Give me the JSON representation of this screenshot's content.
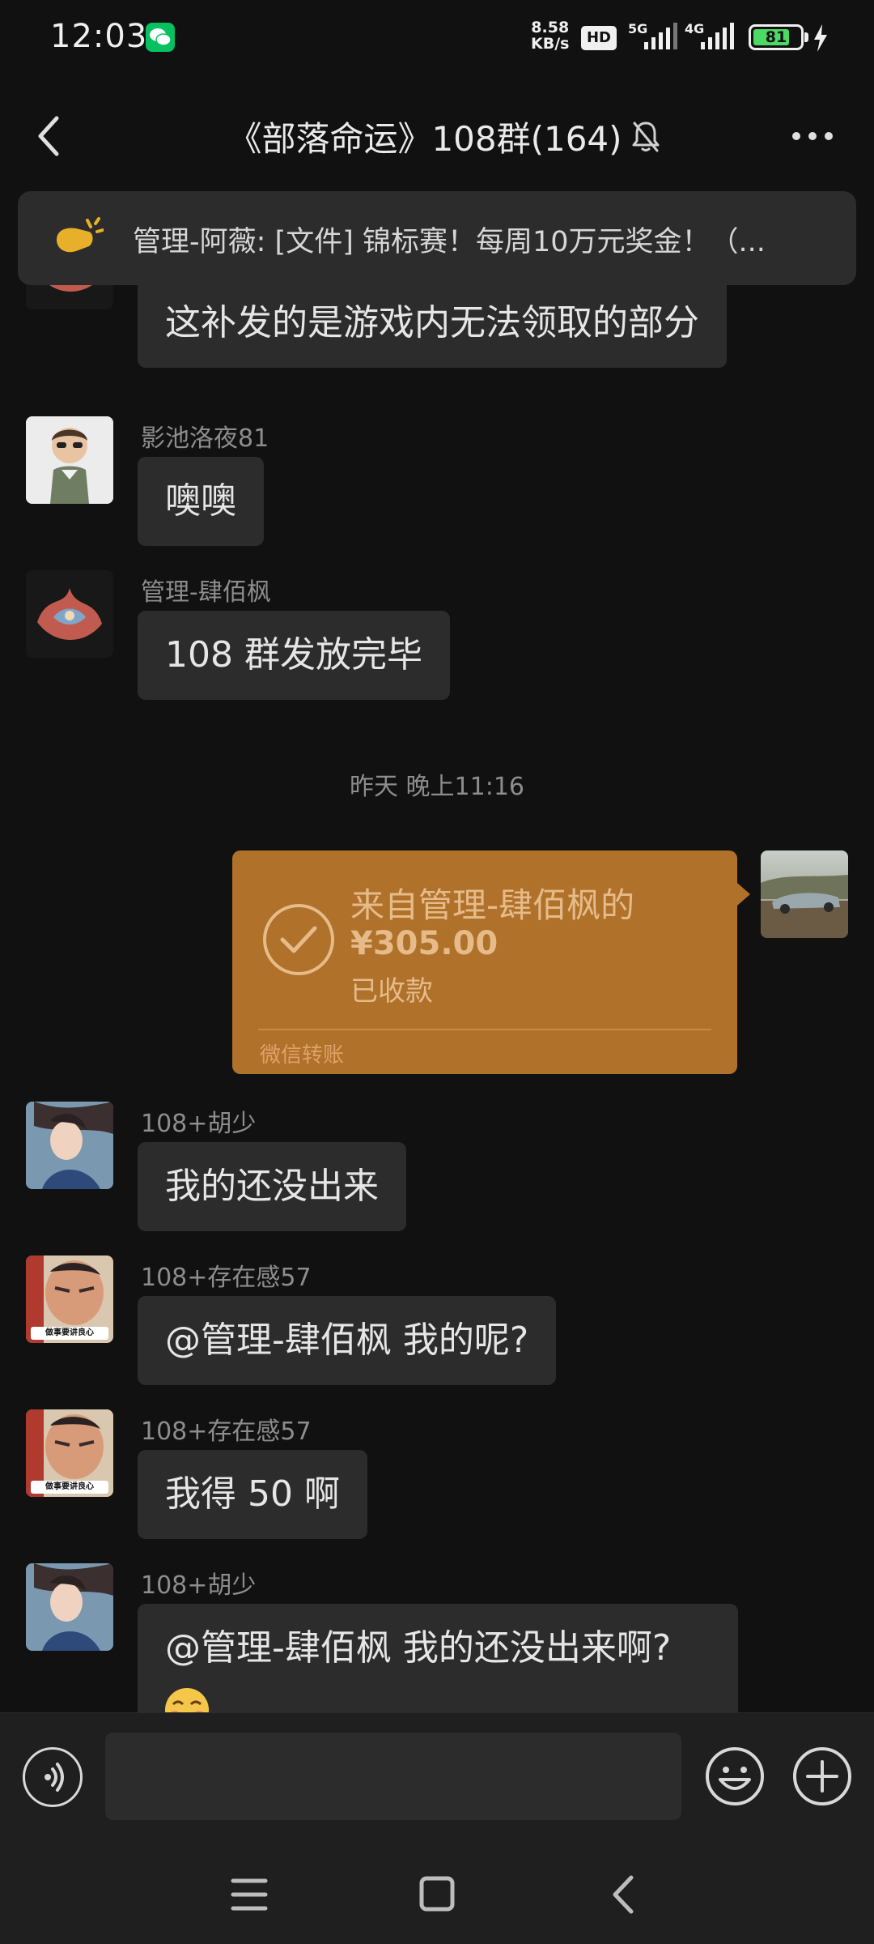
{
  "status_bar": {
    "time": "12:03",
    "net_speed_value": "8.58",
    "net_speed_unit": "KB/s",
    "hd_label": "HD",
    "sim1_label": "5G",
    "sim2_label": "4G",
    "battery": "81",
    "battery_level_pct": 81
  },
  "header": {
    "title": "《部落命运》108群(164)"
  },
  "pinned": {
    "text": "管理-阿薇: [文件] 锦标赛！每周10万元奖金！（..."
  },
  "messages": [
    {
      "text": "这补发的是游戏内无法领取的部分"
    },
    {
      "sender": "影池洛夜81",
      "text": "噢噢"
    },
    {
      "sender": "管理-肆佰枫",
      "text": "108 群发放完毕"
    },
    {
      "sender": "108+胡少",
      "text": "我的还没出来"
    },
    {
      "sender": "108+存在感57",
      "text": "@管理-肆佰枫  我的呢?"
    },
    {
      "sender": "108+存在感57",
      "text": "我得 50 啊"
    },
    {
      "sender": "108+胡少",
      "text": "@管理-肆佰枫  我的还没出来啊?"
    }
  ],
  "timestamp": "昨天 晚上11:16",
  "transfer": {
    "from": "来自管理-肆佰枫的",
    "amount": "¥305.00",
    "status": "已收款",
    "footer": "微信转账"
  },
  "avatar_badge_text": "做事要讲良心",
  "colors": {
    "background": "#111111",
    "bubble": "#2c2c2c",
    "transfer_received": "#b0712a",
    "wechat_green": "#07c160"
  }
}
